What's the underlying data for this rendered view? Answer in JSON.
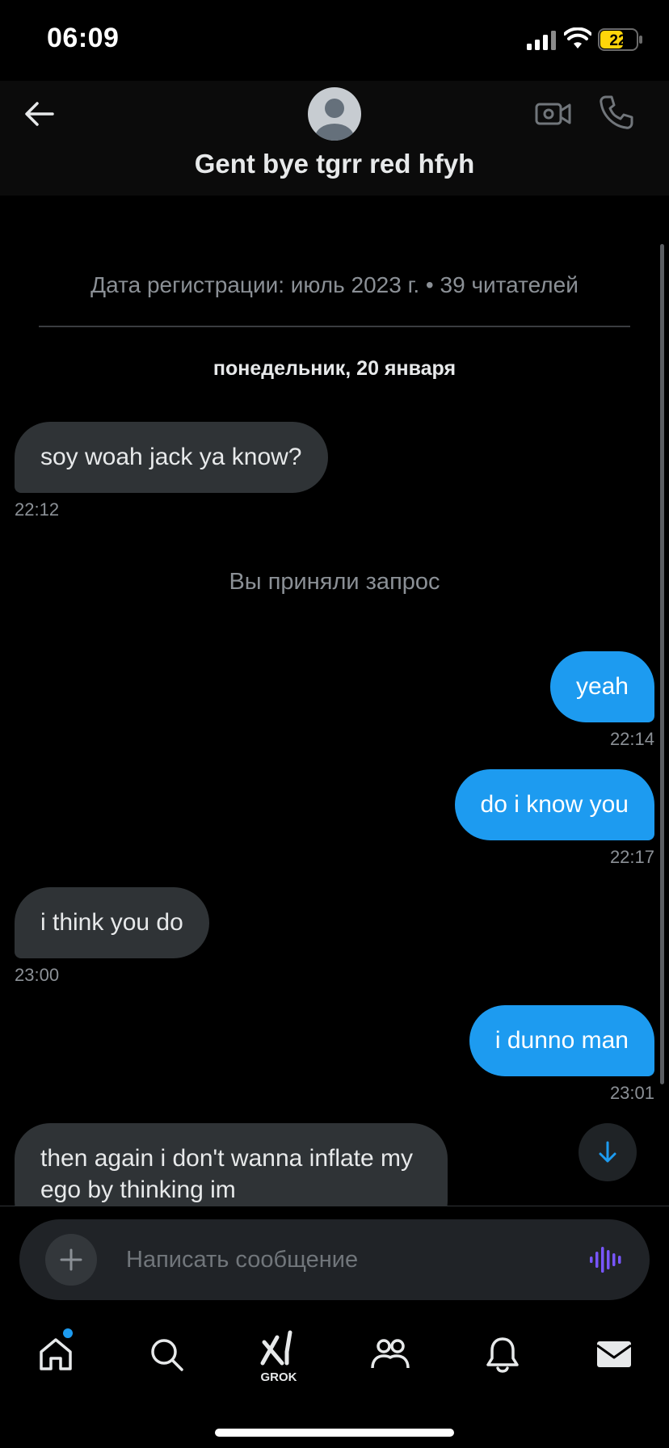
{
  "status_bar": {
    "time": "06:09",
    "battery": "22"
  },
  "header": {
    "contact_name": "Gent bye tgrr red hfyh"
  },
  "chat": {
    "registration_info": "Дата регистрации: июль 2023 г. • 39 читателей",
    "date_separator": "понедельник, 20 января",
    "accepted_notice": "Вы приняли запрос",
    "messages": [
      {
        "direction": "in",
        "text": "soy woah jack ya know?",
        "time": "22:12"
      },
      {
        "direction": "out",
        "text": "yeah",
        "time": "22:14"
      },
      {
        "direction": "out",
        "text": "do i know you",
        "time": "22:17"
      },
      {
        "direction": "in",
        "text": "i think you do",
        "time": "23:00"
      },
      {
        "direction": "out",
        "text": "i dunno man",
        "time": "23:01"
      },
      {
        "direction": "in",
        "text": "then again i don't wanna inflate my ego by thinking im"
      }
    ]
  },
  "composer": {
    "placeholder": "Написать сообщение"
  },
  "nav": {
    "grok_label": "GROK"
  },
  "colors": {
    "accent": "#1d9bf0",
    "incoming_bubble": "#2f3336",
    "battery": "#ffd60a",
    "voice_icon": "#7856ff"
  }
}
